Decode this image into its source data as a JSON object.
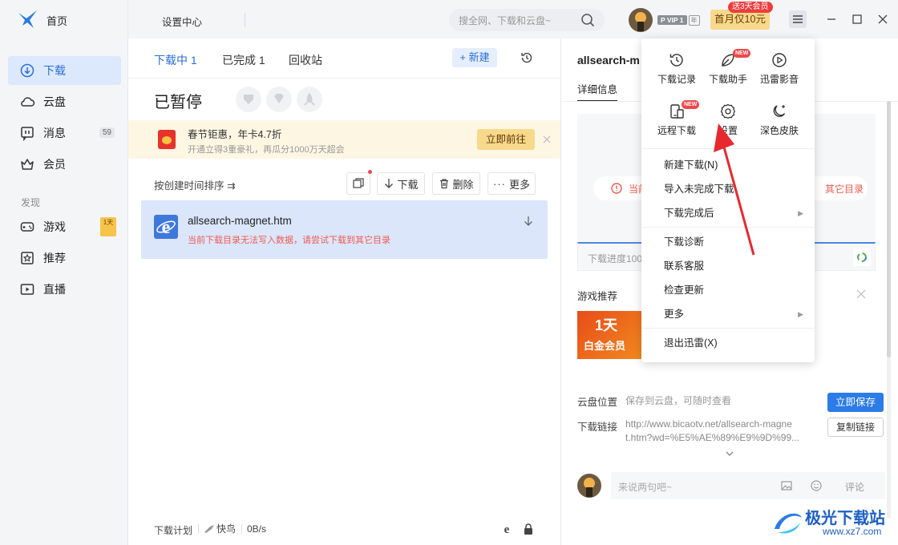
{
  "sidebar": {
    "items": [
      {
        "label": "首页",
        "icon": "bird-logo-icon"
      },
      {
        "label": "下载",
        "icon": "download-icon",
        "active": true
      },
      {
        "label": "云盘",
        "icon": "cloud-icon"
      },
      {
        "label": "消息",
        "icon": "message-icon",
        "badge": "59"
      },
      {
        "label": "会员",
        "icon": "crown-icon"
      }
    ],
    "section_label": "发现",
    "discover": [
      {
        "label": "游戏",
        "icon": "gamepad-icon",
        "tag": "1天"
      },
      {
        "label": "推荐",
        "icon": "star-icon"
      },
      {
        "label": "直播",
        "icon": "live-icon"
      }
    ]
  },
  "topbar": {
    "settings_center": "设置中心",
    "search_placeholder": "搜全网、下载和云盘~",
    "vip_badge": "P VIP 1",
    "vip_year": "年",
    "promo_bubble": "送3天会员",
    "promo_button": "首月仅10元"
  },
  "download_panel": {
    "tabs": [
      "下载中 1",
      "已完成 1",
      "回收站"
    ],
    "new_button": "+ 新建",
    "status_title": "已暂停",
    "banner": {
      "title": "春节钜惠，年卡4.7折",
      "subtitle": "开通立得3重豪礼，再瓜分1000万天超会",
      "action": "立即前往"
    },
    "sort_label": "按创建时间排序 ⇉",
    "toolbar": {
      "download": "下载",
      "delete": "删除",
      "more": "更多"
    },
    "file": {
      "name": "allsearch-magnet.htm",
      "error": "当前下载目录无法写入数据，请尝试下载到其它目录"
    },
    "footer": {
      "plan": "下载计划",
      "speed_label": "快鸟",
      "speed": "0B/s"
    }
  },
  "detail": {
    "title": "allsearch-m",
    "tab": "详细信息",
    "error_left": "当前",
    "error_right": "其它目录",
    "progress": "下载进度100",
    "game_rec": "游戏推荐",
    "game_card_line1": "1天",
    "game_card_line2": "白金会员",
    "cloud_label": "云盘位置",
    "cloud_hint": "保存到云盘，可随时查看",
    "save_now": "立即保存",
    "link_label": "下载链接",
    "link_line1": "http://www.bicaotv.net/allsearch-magne",
    "link_line2": "t.htm?wd=%E5%AE%89%E9%9D%99...",
    "copy_link": "复制链接",
    "comment_placeholder": "来说两句吧~",
    "comment_button": "评论"
  },
  "menu": {
    "grid": [
      {
        "label": "下载记录",
        "icon": "history-icon"
      },
      {
        "label": "下载助手",
        "icon": "leaf-icon",
        "badge": "NEW"
      },
      {
        "label": "迅雷影音",
        "icon": "play-circle-icon"
      },
      {
        "label": "远程下载",
        "icon": "remote-device-icon",
        "badge": "NEW"
      },
      {
        "label": "设置",
        "icon": "gear-icon"
      },
      {
        "label": "深色皮肤",
        "icon": "moon-icon"
      }
    ],
    "items": [
      {
        "label": "新建下载(N)"
      },
      {
        "label": "导入未完成下载"
      },
      {
        "label": "下载完成后",
        "submenu": true
      },
      {
        "label": "下载诊断"
      },
      {
        "label": "联系客服"
      },
      {
        "label": "检查更新"
      },
      {
        "label": "更多",
        "submenu": true
      },
      {
        "label": "退出迅雷(X)"
      }
    ]
  },
  "watermark": {
    "text": "极光下载站",
    "url": "www.xz7.com"
  },
  "colors": {
    "accent": "#2b6fd6",
    "error": "#f05a4f",
    "arrow": "#e8282f"
  }
}
